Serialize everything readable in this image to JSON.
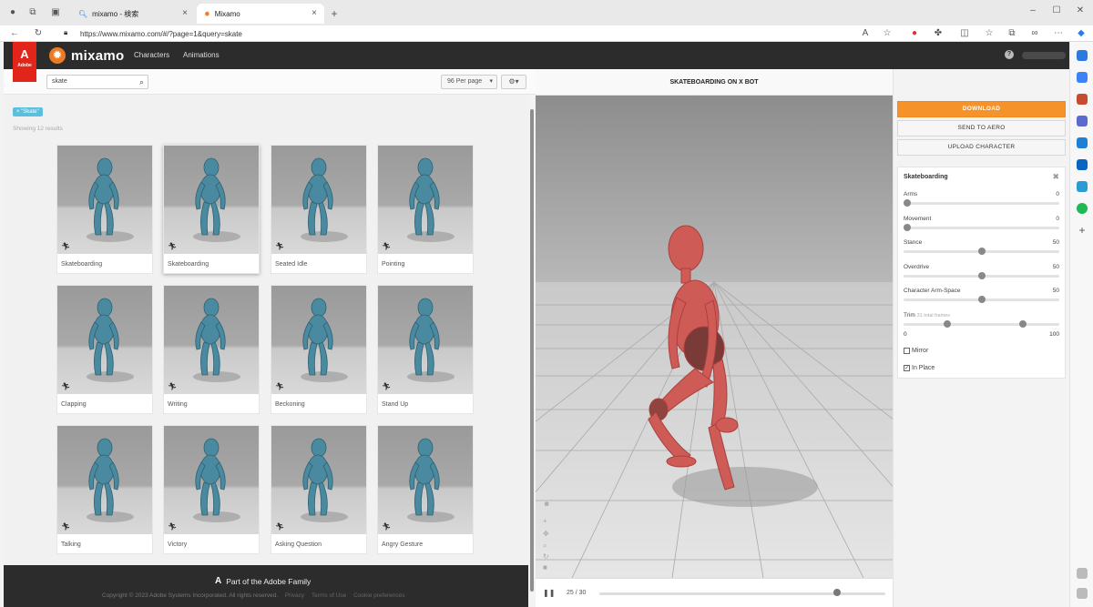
{
  "browser": {
    "tabs": [
      {
        "label": "mixamo - 検索",
        "active": false
      },
      {
        "label": "Mixamo",
        "active": true
      }
    ],
    "url": "https://www.mixamo.com/#/?page=1&query=skate"
  },
  "nav": {
    "adobe_logo_text": "Adobe",
    "brand": "mixamo",
    "links": [
      "Characters",
      "Animations"
    ]
  },
  "search": {
    "value": "skate",
    "per_page": "96 Per page",
    "filter_tag": "× \"Skate\"",
    "showing": "Showing 12 results"
  },
  "cards": [
    {
      "label": "Skateboarding"
    },
    {
      "label": "Skateboarding"
    },
    {
      "label": "Seated Idle"
    },
    {
      "label": "Pointing"
    },
    {
      "label": "Clapping"
    },
    {
      "label": "Writing"
    },
    {
      "label": "Beckoning"
    },
    {
      "label": "Stand Up"
    },
    {
      "label": "Talking"
    },
    {
      "label": "Victory"
    },
    {
      "label": "Asking Question"
    },
    {
      "label": "Angry Gesture"
    }
  ],
  "footer": {
    "family": "Part of the Adobe Family",
    "copyright": "Copyright © 2023 Adobe Systems Incorporated. All rights reserved.",
    "links": [
      "Privacy",
      "Terms of Use",
      "Cookie preferences"
    ]
  },
  "viewer": {
    "title": "SKATEBOARDING ON X BOT",
    "frame": "25 / 30",
    "playback_progress": 0.83
  },
  "actions": {
    "download": "DOWNLOAD",
    "send_to_aero": "SEND TO AERO",
    "upload": "UPLOAD CHARACTER"
  },
  "settings": {
    "title": "Skateboarding",
    "sliders": [
      {
        "name": "Arms",
        "value": "0",
        "level": 0
      },
      {
        "name": "Movement",
        "value": "0",
        "level": 0
      },
      {
        "name": "Stance",
        "value": "50",
        "level": 0.5
      },
      {
        "name": "Overdrive",
        "value": "50",
        "level": 0.5
      },
      {
        "name": "Character Arm-Space",
        "value": "50",
        "level": 0.5
      }
    ],
    "trim": {
      "label": "Trim",
      "frames": "31 total frames",
      "min": "0",
      "max": "100",
      "start": 0.26,
      "end": 0.74
    },
    "mirror": {
      "label": "Mirror",
      "checked": false
    },
    "in_place": {
      "label": "In Place",
      "checked": true
    }
  },
  "colors": {
    "adobe_red": "#e1251b",
    "download_orange": "#f5922a",
    "tag_blue": "#5bc0de",
    "character_teal": "#4a8aa0",
    "character_red": "#cf5b57"
  }
}
